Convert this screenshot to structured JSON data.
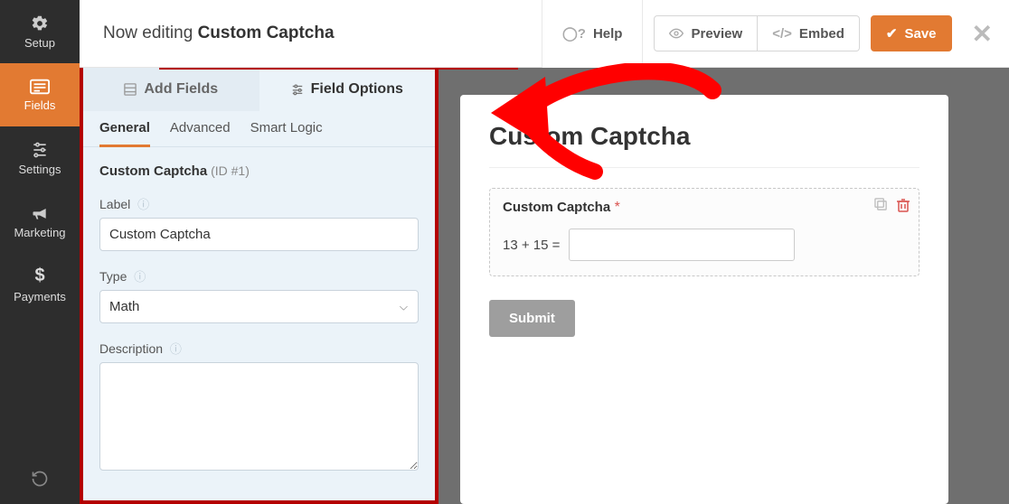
{
  "header": {
    "prefix": "Now editing",
    "form_name": "Custom Captcha",
    "help": "Help",
    "preview": "Preview",
    "embed": "Embed",
    "save": "Save"
  },
  "leftnav": {
    "setup": "Setup",
    "fields": "Fields",
    "settings": "Settings",
    "marketing": "Marketing",
    "payments": "Payments"
  },
  "panel": {
    "tabs": {
      "add_fields": "Add Fields",
      "field_options": "Field Options"
    },
    "subtabs": {
      "general": "General",
      "advanced": "Advanced",
      "smart_logic": "Smart Logic"
    },
    "field_name": "Custom Captcha",
    "field_id": "(ID #1)",
    "label_label": "Label",
    "label_value": "Custom Captcha",
    "type_label": "Type",
    "type_value": "Math",
    "desc_label": "Description",
    "desc_value": ""
  },
  "preview": {
    "form_title": "Custom Captcha",
    "field_title": "Custom Captcha",
    "required_mark": "*",
    "math_question": "13 + 15 =",
    "math_value": "",
    "submit": "Submit"
  }
}
